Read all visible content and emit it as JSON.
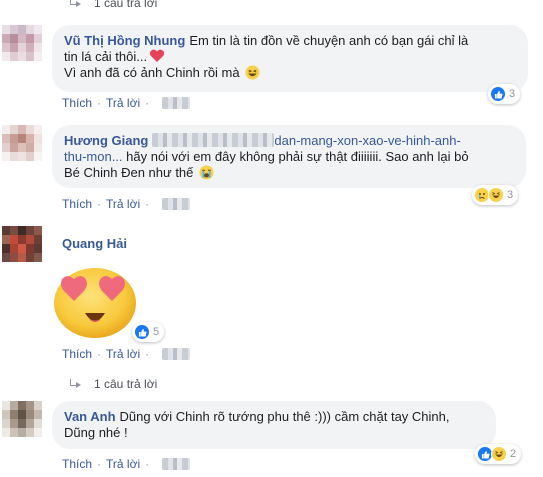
{
  "top_reply": {
    "text": "1 câu trả lời"
  },
  "comments": [
    {
      "author": "Vũ Thị Hồng Nhung",
      "line1": "Em tin là tin đồn về chuyện anh có bạn gái chỉ là",
      "line2": "tin lá cải thôi...",
      "line3": "Vì anh đã có ảnh Chinh rồi mà",
      "like": "Thích",
      "reply": "Trả lời",
      "reactions": [
        "like-icon"
      ],
      "count": "3"
    },
    {
      "author": "Hương Giang",
      "link_part1": "dan-mang-xon-xao-ve-hinh-anh-",
      "link_part2": "thu-mon...",
      "text_rest": " hãy nói với em đây không phải sự thật điiiiiii. Sao anh lại bỏ",
      "line3": "Bé Chinh Đen như thế",
      "like": "Thích",
      "reply": "Trả lời",
      "reactions": [
        "sad-icon",
        "haha-icon"
      ],
      "count": "3"
    },
    {
      "author": "Quang Hải",
      "like": "Thích",
      "reply": "Trả lời",
      "reactions": [
        "like-icon"
      ],
      "count": "5"
    },
    {
      "author": "Van Anh",
      "line1": "Dũng với Chinh rõ tướng phu thê :))) cầm chặt tay Chinh,",
      "line2": "Dũng nhé !",
      "like": "Thích",
      "reply": "Trả lời",
      "reactions": [
        "like-icon",
        "haha-icon"
      ],
      "count": "2"
    }
  ],
  "bottom_reply": {
    "text": "1 câu trả lời"
  },
  "separator": "·",
  "colors": {
    "link": "#385898",
    "bubble": "#f2f3f5",
    "like": "#1877f2",
    "emoji": "#f7d14c",
    "heart": "#e8425a"
  }
}
